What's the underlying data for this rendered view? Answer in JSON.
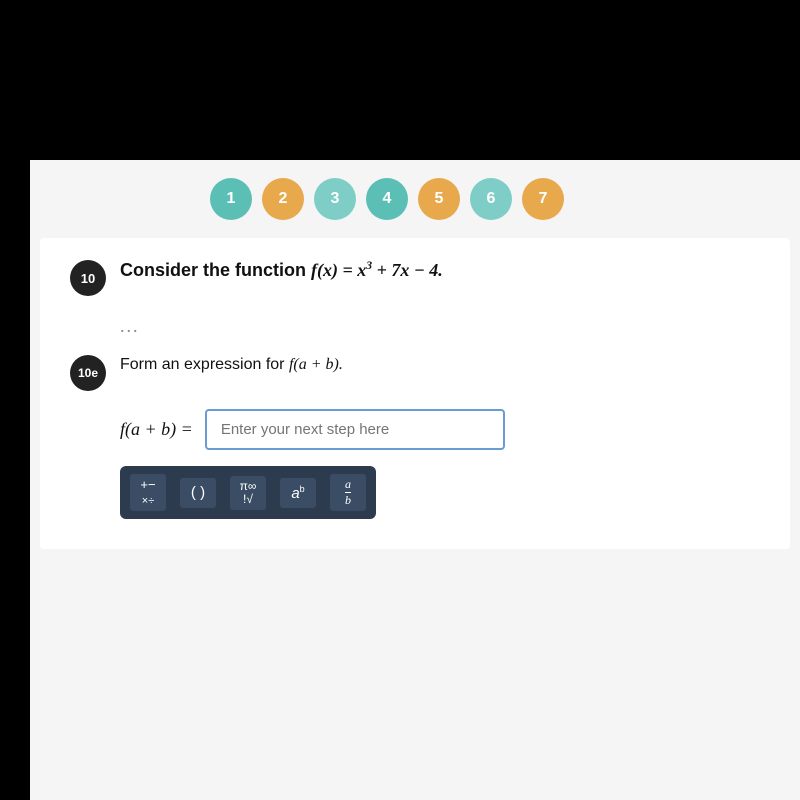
{
  "screen": {
    "background": "#f5f5f5"
  },
  "stepNav": {
    "steps": [
      {
        "label": "1",
        "color": "teal"
      },
      {
        "label": "2",
        "color": "orange"
      },
      {
        "label": "3",
        "color": "teal-light"
      },
      {
        "label": "4",
        "color": "teal2"
      },
      {
        "label": "5",
        "color": "orange2"
      },
      {
        "label": "6",
        "color": "teal3"
      },
      {
        "label": "7",
        "color": "orange3"
      }
    ]
  },
  "question": {
    "badge": "10",
    "text_prefix": "Consider the function ",
    "function_label": "f(x)",
    "equals": " = ",
    "function_body": "x³ + 7x − 4.",
    "ellipsis": "..."
  },
  "subQuestion": {
    "badge": "10e",
    "text_prefix": "Form an expression for ",
    "target_function": "f(a + b)."
  },
  "expressionInput": {
    "label": "f(a + b) =",
    "placeholder": "Enter your next step here"
  },
  "toolbar": {
    "buttons": [
      {
        "id": "ops",
        "label": "+-\nx÷"
      },
      {
        "id": "parens",
        "label": "( )"
      },
      {
        "id": "symbols",
        "label": "π∞\n!√"
      },
      {
        "id": "power",
        "label": "aᵇ"
      },
      {
        "id": "fraction",
        "label": "a/b"
      }
    ]
  }
}
